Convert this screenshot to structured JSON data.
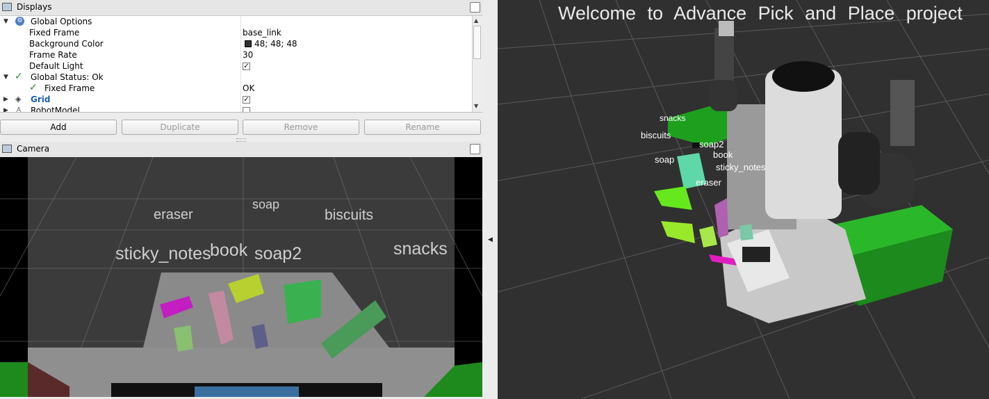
{
  "displays": {
    "title": "Displays",
    "rows": [
      {
        "label": "Global Options",
        "value": ""
      },
      {
        "label": "Fixed Frame",
        "value": "base_link"
      },
      {
        "label": "Background Color",
        "value": "48; 48; 48"
      },
      {
        "label": "Frame Rate",
        "value": "30"
      },
      {
        "label": "Default Light",
        "value": ""
      },
      {
        "label": "Global Status: Ok",
        "value": ""
      },
      {
        "label": "Fixed Frame",
        "value": "OK"
      },
      {
        "label": "Grid",
        "value": ""
      },
      {
        "label": "RobotModel",
        "value": ""
      }
    ],
    "colors": {
      "grid_label": "#1a5fb4",
      "status_ok": "#2a8a2a",
      "bg_swatch": "#303030"
    }
  },
  "buttons": {
    "add": "Add",
    "duplicate": "Duplicate",
    "remove": "Remove",
    "rename": "Rename"
  },
  "camera": {
    "title": "Camera",
    "labels": {
      "eraser": "eraser",
      "soap": "soap",
      "biscuits": "biscuits",
      "sticky_notes": "sticky_notes",
      "book": "book",
      "soap2": "soap2",
      "snacks": "snacks"
    }
  },
  "view3d": {
    "banner": "Welcome to Advance Pick and Place project",
    "labels": {
      "snacks": "snacks",
      "biscuits": "biscuits",
      "soap2": "soap2",
      "book": "book",
      "soap": "soap",
      "sticky_notes": "sticky_notes",
      "eraser": "eraser"
    },
    "background": "#303030"
  }
}
